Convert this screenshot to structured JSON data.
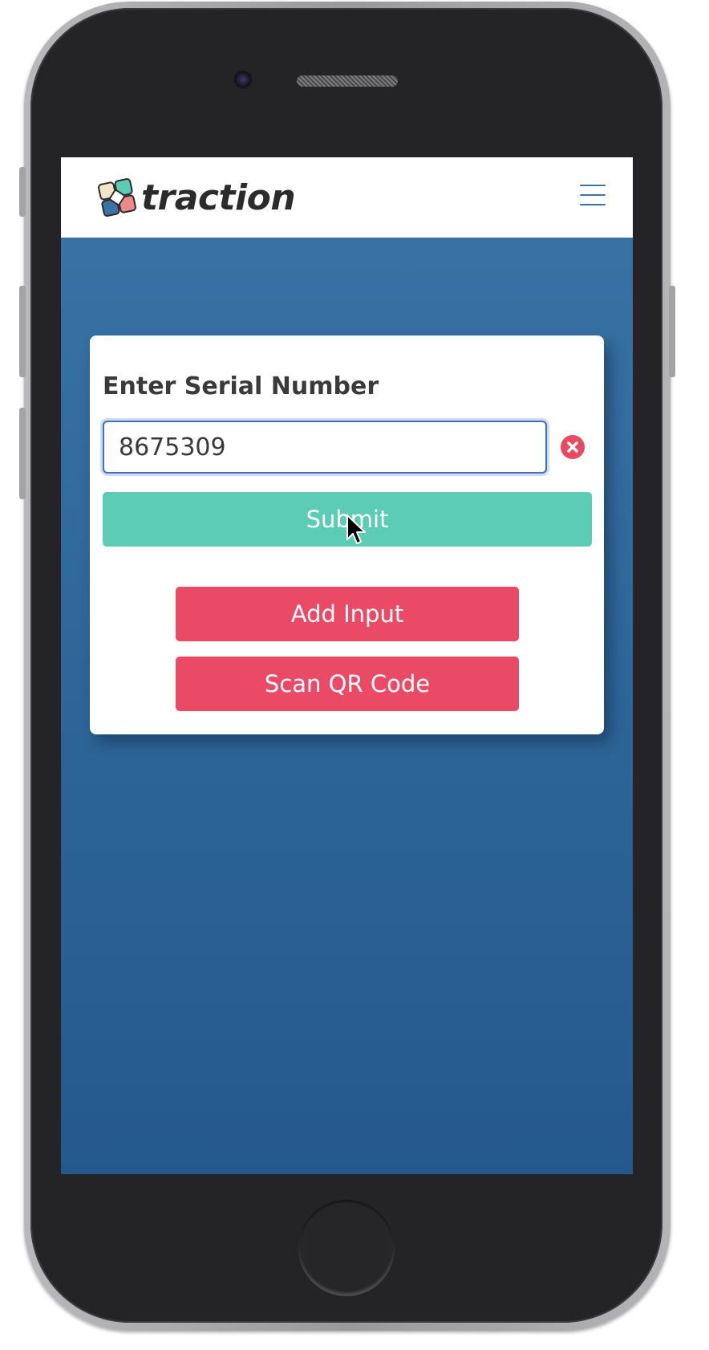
{
  "app": {
    "name": "traction"
  },
  "navbar": {
    "logo_text": "traction",
    "menu_icon": "hamburger-menu-icon"
  },
  "form": {
    "title": "Enter Serial Number",
    "serial_input": {
      "value": "8675309",
      "placeholder": ""
    },
    "clear_icon": "close-circle-icon",
    "submit_label": "Submit",
    "add_input_label": "Add Input",
    "scan_qr_label": "Scan QR Code"
  },
  "colors": {
    "background_blue": "#3a74a7",
    "submit_green": "#5ccdb4",
    "action_red": "#ea4a65",
    "focus_blue": "#3d6fc2"
  }
}
